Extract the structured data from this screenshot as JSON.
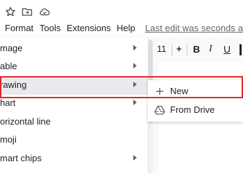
{
  "top_icons": [
    "star-icon",
    "move-to-folder-icon",
    "cloud-saved-icon"
  ],
  "menubar": {
    "items": [
      "Format",
      "Tools",
      "Extensions",
      "Help"
    ],
    "last_edit": "Last edit was seconds ago"
  },
  "toolbar": {
    "font_size": "11",
    "plus": "+",
    "bold": "B",
    "italic": "I",
    "underline": "U"
  },
  "insert_menu": {
    "items": [
      {
        "label": "mage",
        "submenu": true
      },
      {
        "label": "able",
        "submenu": true
      },
      {
        "label": "rawing",
        "submenu": true,
        "active": true
      },
      {
        "label": "hart",
        "submenu": true
      },
      {
        "label": "orizontal line",
        "submenu": false
      },
      {
        "label": "moji",
        "submenu": false
      },
      {
        "label": "mart chips",
        "submenu": true
      }
    ]
  },
  "drawing_submenu": {
    "items": [
      {
        "label": "New",
        "icon": "plus-icon"
      },
      {
        "label": "From Drive",
        "icon": "google-drive-icon"
      }
    ]
  },
  "colors": {
    "highlight_border": "#e3242b",
    "active_row": "#e8eaed",
    "canvas_bg": "#f8f9fa"
  }
}
